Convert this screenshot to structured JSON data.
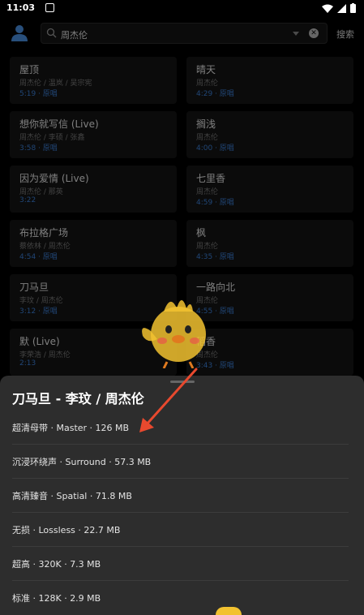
{
  "status_bar": {
    "time": "11:03"
  },
  "search": {
    "query": "周杰伦",
    "button_label": "搜索"
  },
  "songs": [
    {
      "title": "屋顶",
      "artist": "周杰伦 / 温岚 / 吴宗宪",
      "meta": "5:19 · 原唱"
    },
    {
      "title": "晴天",
      "artist": "周杰伦",
      "meta": "4:29 · 原唱"
    },
    {
      "title": "想你就写信 (Live)",
      "artist": "周杰伦 / 李硕 / 张鑫",
      "meta": "3:58 · 原唱"
    },
    {
      "title": "搁浅",
      "artist": "周杰伦",
      "meta": "4:00 · 原唱"
    },
    {
      "title": "因为爱情 (Live)",
      "artist": "周杰伦 / 那英",
      "meta": "3:22"
    },
    {
      "title": "七里香",
      "artist": "周杰伦",
      "meta": "4:59 · 原唱"
    },
    {
      "title": "布拉格广场",
      "artist": "蔡依林 / 周杰伦",
      "meta": "4:54 · 原唱"
    },
    {
      "title": "枫",
      "artist": "周杰伦",
      "meta": "4:35 · 原唱"
    },
    {
      "title": "刀马旦",
      "artist": "李玟 / 周杰伦",
      "meta": "3:12 · 原唱"
    },
    {
      "title": "一路向北",
      "artist": "周杰伦",
      "meta": "4:55 · 原唱"
    },
    {
      "title": "默 (Live)",
      "artist": "李荣浩 / 周杰伦",
      "meta": "2:13"
    },
    {
      "title": "稻香",
      "artist": "周杰伦",
      "meta": "3:43 · 原唱"
    }
  ],
  "sheet": {
    "title": "刀马旦 - 李玟 / 周杰伦",
    "options": [
      {
        "label": "超清母带 · Master · 126 MB"
      },
      {
        "label": "沉浸环绕声 · Surround · 57.3 MB"
      },
      {
        "label": "高清臻音 · Spatial · 71.8 MB"
      },
      {
        "label": "无损 · Lossless · 22.7 MB"
      },
      {
        "label": "超高 · 320K · 7.3 MB"
      },
      {
        "label": "标准 · 128K · 2.9 MB"
      }
    ]
  },
  "colors": {
    "accent": "#3b7fd6",
    "arrow": "#e8492e",
    "avatar": "#4a90e2",
    "mascot": "#f2c230"
  }
}
